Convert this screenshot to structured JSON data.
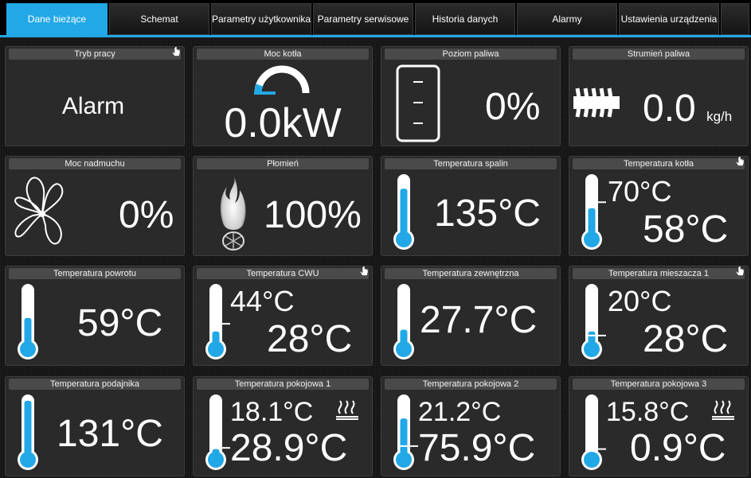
{
  "tabs": [
    {
      "label": "Dane bieżące",
      "active": true
    },
    {
      "label": "Schemat"
    },
    {
      "label": "Parametry użytkownika"
    },
    {
      "label": "Parametry serwisowe"
    },
    {
      "label": "Historia danych"
    },
    {
      "label": "Alarmy"
    },
    {
      "label": "Ustawienia urządzenia"
    }
  ],
  "accent_color": "#22a8e6",
  "tiles": {
    "tryb_pracy": {
      "title": "Tryb pracy",
      "value": "Alarm",
      "icon": "hand-pointer-icon"
    },
    "moc_kotla": {
      "title": "Moc kotła",
      "value": "0.0kW",
      "gauge_fraction": 0.1
    },
    "poziom_paliwa": {
      "title": "Poziom paliwa",
      "value": "0%",
      "level_fraction": 0.0
    },
    "strumien_paliwa": {
      "title": "Strumień paliwa",
      "value": "0.0",
      "unit": "kg/h"
    },
    "moc_nadmuchu": {
      "title": "Moc nadmuchu",
      "value": "0%",
      "icon": "fan-icon"
    },
    "plomien": {
      "title": "Płomień",
      "value": "100%",
      "icon": "flame-icon"
    },
    "temp_spalin": {
      "title": "Temperatura spalin",
      "value": "135°C",
      "fill": 0.78
    },
    "temp_kotla": {
      "title": "Temperatura kotła",
      "set": "70°C",
      "value": "58°C",
      "fill": 0.45,
      "set_mark": 0.55
    },
    "temp_powrotu": {
      "title": "Temperatura powrotu",
      "value": "59°C",
      "fill": 0.45
    },
    "temp_cwu": {
      "title": "Temperatura CWU",
      "set": "44°C",
      "value": "28°C",
      "fill": 0.22,
      "set_mark": 0.35
    },
    "temp_zewn": {
      "title": "Temperatura zewnętrzna",
      "value": "27.7°C",
      "fill": 0.25
    },
    "temp_mieszacza": {
      "title": "Temperatura mieszacza 1",
      "set": "20°C",
      "value": "28°C",
      "fill": 0.22,
      "set_mark": 0.15
    },
    "temp_podajnika": {
      "title": "Temperatura podajnika",
      "value": "131°C",
      "fill": 0.92
    },
    "temp_pok1": {
      "title": "Temperatura pokojowa 1",
      "set": "18.1°C",
      "value": "28.9°C",
      "fill": 0.1,
      "set_mark": 0.12,
      "icon": "heating-icon"
    },
    "temp_pok2": {
      "title": "Temperatura pokojowa 2",
      "set": "21.2°C",
      "value": "75.9°C",
      "fill": 0.62,
      "set_mark": 0.15
    },
    "temp_pok3": {
      "title": "Temperatura pokojowa 3",
      "set": "15.8°C",
      "value": "0.9°C",
      "fill": 0.02,
      "set_mark": 0.1,
      "icon": "heating-icon"
    }
  }
}
